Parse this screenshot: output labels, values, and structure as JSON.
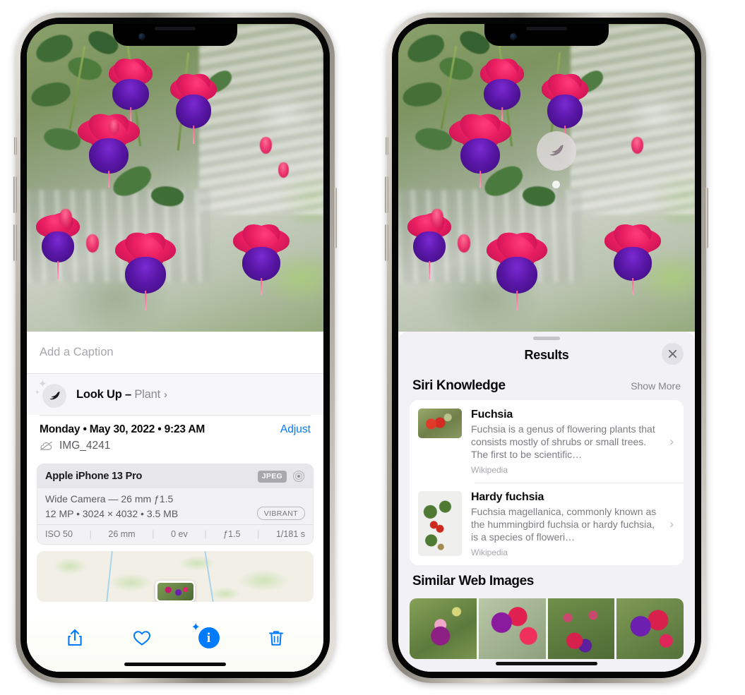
{
  "left_phone": {
    "caption": {
      "placeholder": "Add a Caption",
      "value": ""
    },
    "lookup": {
      "label": "Look Up – ",
      "subject": "Plant",
      "chevron": "›",
      "icon": "leaf-icon"
    },
    "date_row": {
      "date": "Monday • May 30, 2022 • 9:23 AM",
      "adjust_label": "Adjust"
    },
    "file_row": {
      "filename": "IMG_4241",
      "icon": "cloud-slash-icon"
    },
    "exif": {
      "model": "Apple iPhone 13 Pro",
      "format_badge": "JPEG",
      "lens_icon": "aperture-icon",
      "line1": "Wide Camera — 26 mm ƒ",
      "line1_full": "Wide Camera — 26 mm ƒ1.5",
      "line2": "12 MP • 3024 × 4032 • 3.5 MB",
      "vibrant_badge": "VIBRANT",
      "stats": [
        "ISO 50",
        "26 mm",
        "0 ev",
        "ƒ1.5",
        "1/181 s"
      ]
    },
    "toolbar": {
      "share_label": "share-icon",
      "favorite_label": "heart-icon",
      "info_label": "info-sparkle-icon",
      "delete_label": "trash-icon"
    }
  },
  "right_phone": {
    "visual_lookup_badge": "leaf-icon",
    "sheet": {
      "title": "Results",
      "close_label": "✕"
    },
    "siri_knowledge": {
      "title": "Siri Knowledge",
      "show_more": "Show More",
      "results": [
        {
          "title": "Fuchsia",
          "description": "Fuchsia is a genus of flowering plants that consists mostly of shrubs or small trees. The first to be scientific…",
          "source": "Wikipedia",
          "chevron": "›"
        },
        {
          "title": "Hardy fuchsia",
          "description": "Fuchsia magellanica, commonly known as the hummingbird fuchsia or hardy fuchsia, is a species of floweri…",
          "source": "Wikipedia",
          "chevron": "›"
        }
      ]
    },
    "similar_web_images": {
      "title": "Similar Web Images",
      "count": 4
    }
  },
  "colors": {
    "accent_blue": "#007AFF",
    "sheet_bg": "#F2F1F6",
    "card_bg": "#FFFFFF",
    "secondary_text": "#7C7C83"
  }
}
